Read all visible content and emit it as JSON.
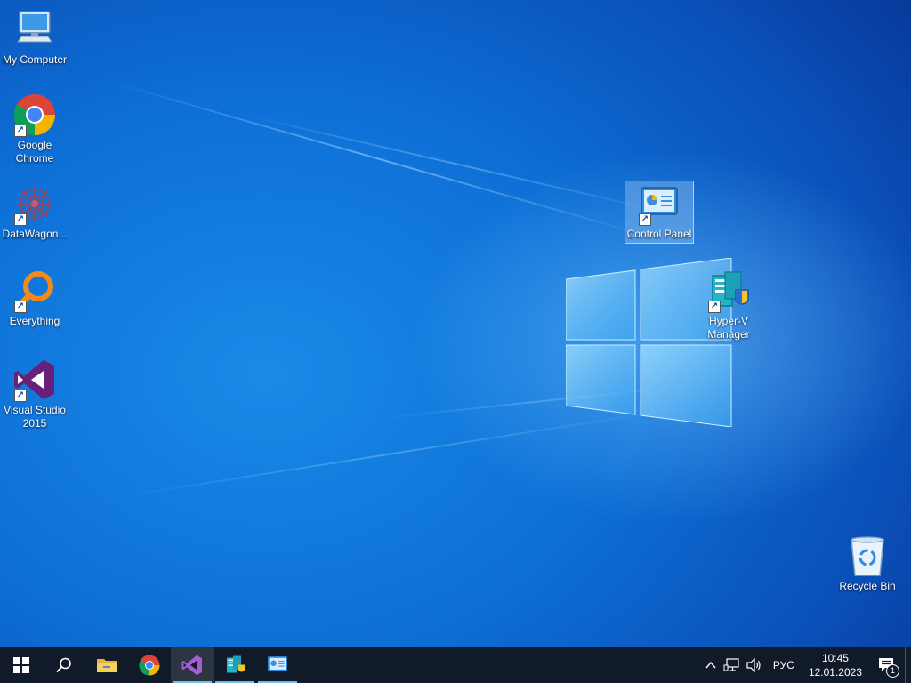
{
  "desktop": {
    "icons": [
      {
        "id": "my-computer",
        "label": "My Computer",
        "icon": "computer-icon"
      },
      {
        "id": "google-chrome",
        "label": "Google Chrome",
        "icon": "chrome-icon"
      },
      {
        "id": "datawagon",
        "label": "DataWagon...",
        "icon": "datawagon-icon"
      },
      {
        "id": "everything",
        "label": "Everything",
        "icon": "everything-icon"
      },
      {
        "id": "visual-studio",
        "label": "Visual Studio 2015",
        "icon": "visual-studio-icon"
      },
      {
        "id": "control-panel",
        "label": "Control Panel",
        "icon": "control-panel-icon",
        "selected": true
      },
      {
        "id": "hyper-v",
        "label": "Hyper-V Manager",
        "icon": "hyper-v-icon"
      },
      {
        "id": "recycle-bin",
        "label": "Recycle Bin",
        "icon": "recycle-bin-icon"
      }
    ]
  },
  "taskbar": {
    "buttons": [
      {
        "id": "start",
        "icon": "windows-start-icon"
      },
      {
        "id": "search",
        "icon": "search-icon"
      },
      {
        "id": "file-explorer",
        "icon": "folder-icon"
      },
      {
        "id": "chrome",
        "icon": "chrome-icon"
      },
      {
        "id": "visual-studio",
        "icon": "visual-studio-icon",
        "active": true
      },
      {
        "id": "hyper-v",
        "icon": "hyper-v-icon",
        "running": true
      },
      {
        "id": "control-panel",
        "icon": "control-panel-icon",
        "running": true
      }
    ],
    "tray": {
      "language": "РУС",
      "time": "10:45",
      "date": "12.01.2023",
      "notification_count": "1"
    }
  },
  "colors": {
    "taskbar_bg": "#101a28",
    "accent": "#76b9ed",
    "desktop_blue": "#0d6fd6"
  }
}
